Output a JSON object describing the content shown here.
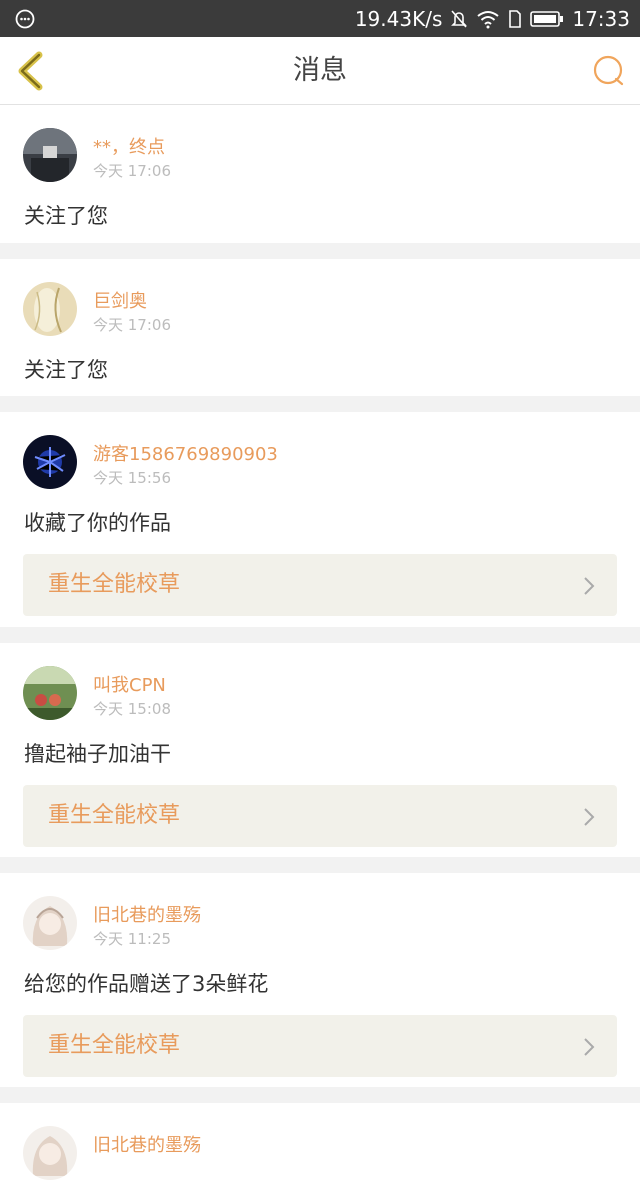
{
  "status_bar": {
    "network_speed": "19.43K/s",
    "time": "17:33"
  },
  "header": {
    "title": "消息"
  },
  "colors": {
    "accent": "#e89b5c",
    "back_arrow": "#c9b020",
    "work_bg": "#f2f1ea"
  },
  "messages": [
    {
      "name": "**，终点",
      "time": "今天 17:06",
      "text": "关注了您"
    },
    {
      "name": "巨剑奥",
      "time": "今天 17:06",
      "text": "关注了您"
    },
    {
      "name": "游客1586769890903",
      "time": "今天 15:56",
      "text": "收藏了你的作品",
      "work": "重生全能校草"
    },
    {
      "name": "叫我CPN",
      "time": "今天 15:08",
      "text": "撸起袖子加油干",
      "work": "重生全能校草"
    },
    {
      "name": "旧北巷的墨殇",
      "time": "今天 11:25",
      "text": "给您的作品赠送了3朵鲜花",
      "work": "重生全能校草"
    },
    {
      "name": "旧北巷的墨殇"
    }
  ]
}
